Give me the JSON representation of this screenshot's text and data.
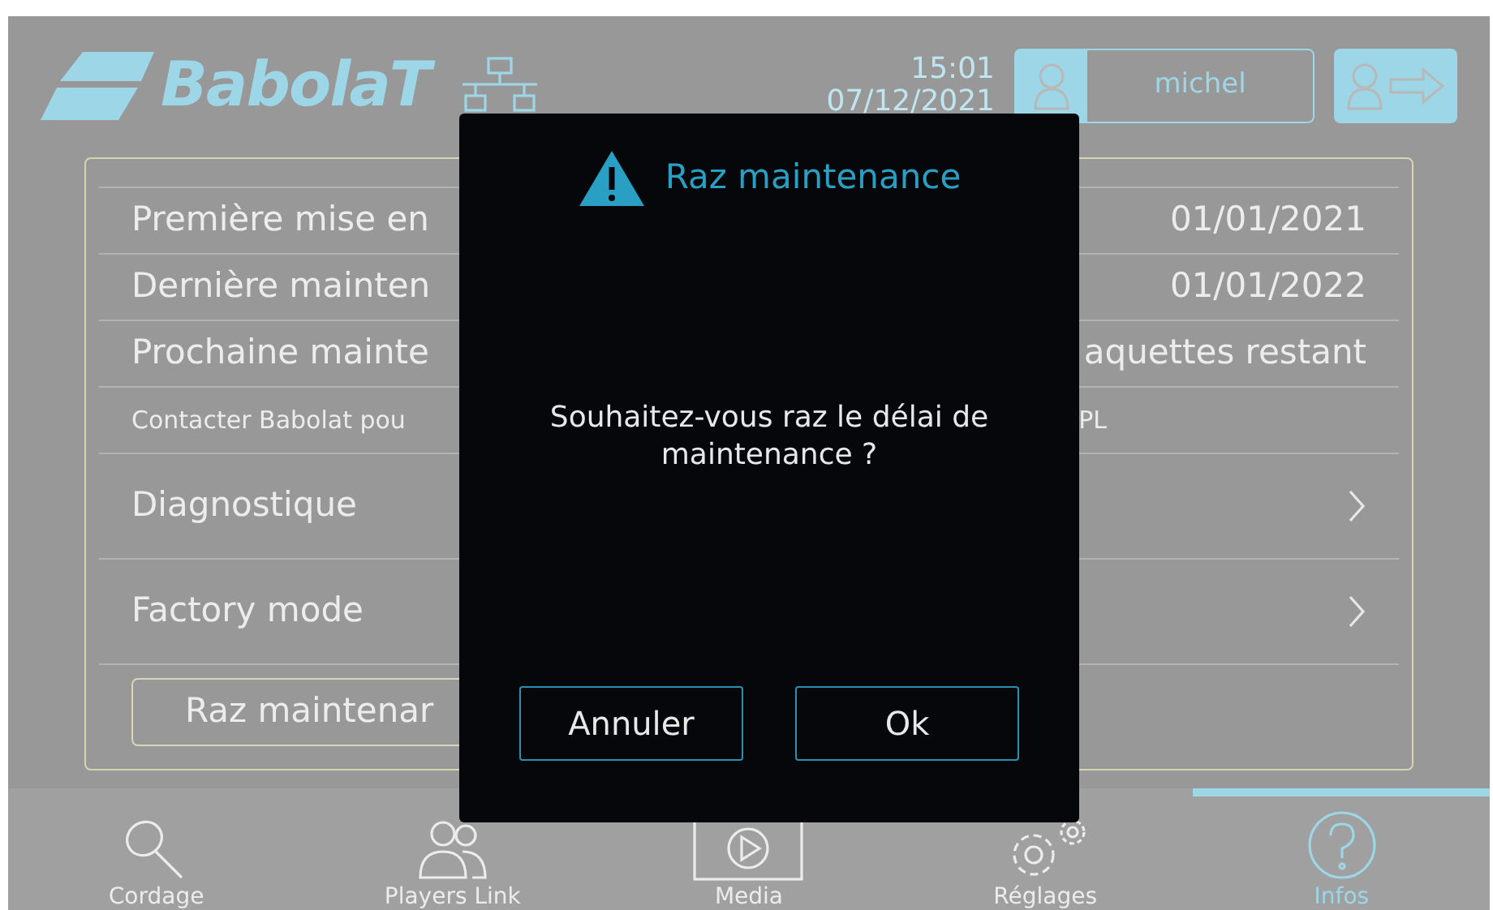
{
  "header": {
    "logo": "BabolaT",
    "time": "15:01",
    "date": "07/12/2021",
    "user": "michel"
  },
  "rows": [
    {
      "kind": "info",
      "label": "Première mise en",
      "value": "01/01/2021"
    },
    {
      "kind": "info",
      "label": "Dernière mainten",
      "value": "01/01/2022"
    },
    {
      "kind": "info",
      "label": "Prochaine mainte",
      "value": "aquettes restant"
    },
    {
      "kind": "note",
      "label": "Contacter Babolat pou",
      "value": "PL"
    },
    {
      "kind": "link",
      "label": "Diagnostique"
    },
    {
      "kind": "link",
      "label": "Factory mode"
    },
    {
      "kind": "button",
      "label": "Raz maintenar"
    }
  ],
  "dialog": {
    "title": "Raz maintenance",
    "message": "Souhaitez-vous raz le délai de maintenance ?",
    "buttons": [
      "Annuler",
      "Ok"
    ]
  },
  "nav": [
    {
      "label": "Cordage",
      "selected": false
    },
    {
      "label": "Players Link",
      "selected": false
    },
    {
      "label": "Media",
      "selected": false
    },
    {
      "label": "Réglages",
      "selected": false
    },
    {
      "label": "Infos",
      "selected": true
    }
  ]
}
